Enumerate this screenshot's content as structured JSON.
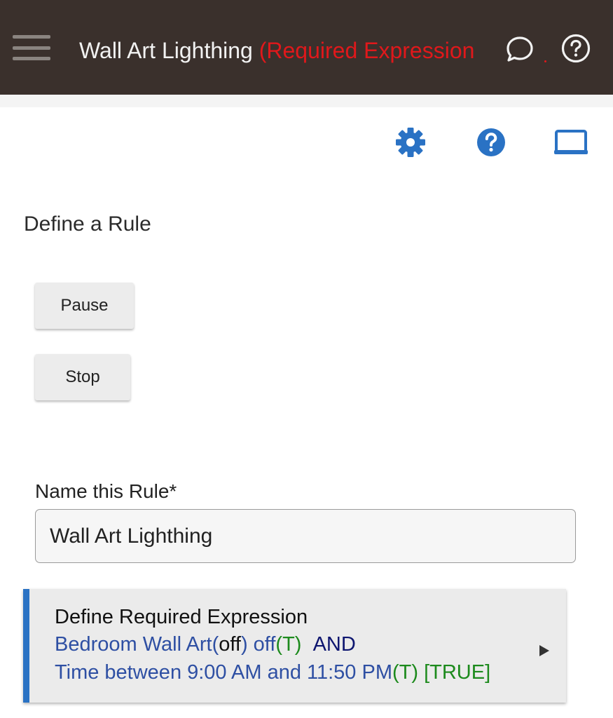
{
  "header": {
    "app_name": "Wall Art Lighthing",
    "app_suffix": "(Required Expression",
    "icons": {
      "menu": "hamburger-menu-icon",
      "chat": "chat-bubble-icon",
      "help": "help-circle-icon"
    }
  },
  "toolbar": {
    "icons": [
      "gear-icon",
      "help-icon",
      "screen-icon"
    ],
    "accent_color": "#2a72c4"
  },
  "page": {
    "section_title": "Define a Rule",
    "pause_label": "Pause",
    "stop_label": "Stop"
  },
  "form": {
    "name_label": "Name this Rule*",
    "name_value": "Wall Art Lighthing"
  },
  "expression": {
    "title": "Define Required Expression",
    "line1": {
      "device": "Bedroom Wall Art",
      "paren_open": "(",
      "state": "off",
      "paren_close": ")",
      "condition": " off",
      "truth": "(T)",
      "operator": "AND"
    },
    "line2": {
      "text": "Time between 9:00 AM and 11:50 PM",
      "truth": "(T)",
      "result": "[TRUE]"
    }
  },
  "colors": {
    "header_bg": "#3a302c",
    "required_red": "#e0181b",
    "link_blue": "#2e4fa3",
    "true_green": "#1c8a1c"
  }
}
